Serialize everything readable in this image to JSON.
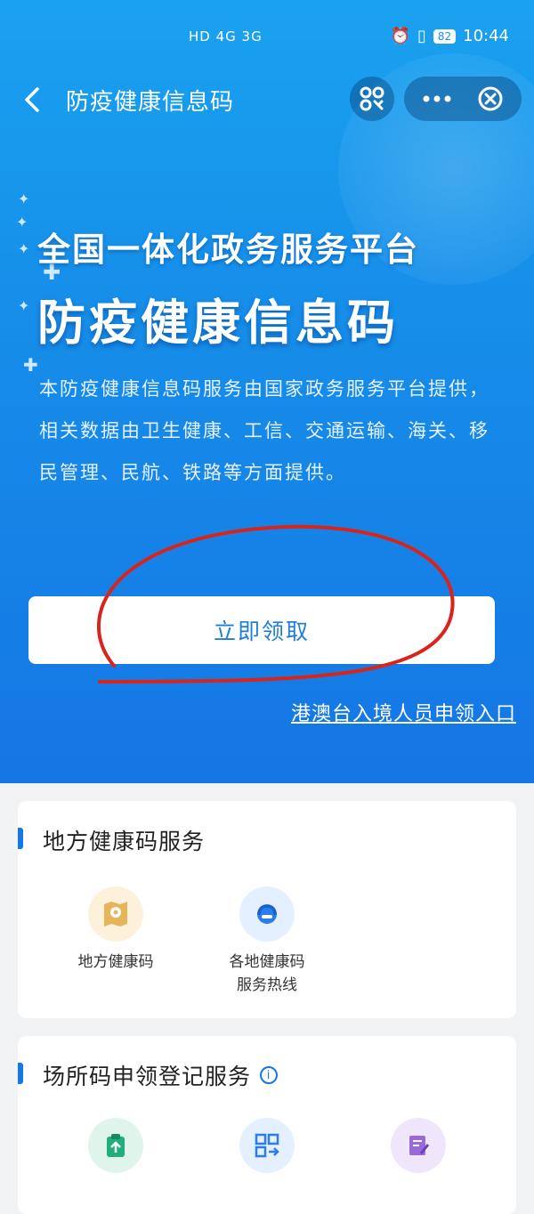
{
  "status_bar": {
    "left": "HD 4G 3G",
    "battery": "82",
    "time": "10:44"
  },
  "nav": {
    "title": "防疫健康信息码"
  },
  "hero": {
    "heading1": "全国一体化政务服务平台",
    "heading2": "防疫健康信息码",
    "description": "本防疫健康信息码服务由国家政务服务平台提供，相关数据由卫生健康、工信、交通运输、海关、移民管理、民航、铁路等方面提供。",
    "claim_button": "立即领取",
    "entry_link": "港澳台入境人员申领入口"
  },
  "local_services": {
    "title": "地方健康码服务",
    "items": [
      {
        "label": "地方健康码",
        "icon": "map-pin-icon"
      },
      {
        "label": "各地健康码\n服务热线",
        "icon": "headset-icon"
      }
    ]
  },
  "venue_services": {
    "title": "场所码申领登记服务",
    "info_icon": "info-icon",
    "items": [
      {
        "icon": "clipboard-upload-icon"
      },
      {
        "icon": "qr-arrow-icon"
      },
      {
        "icon": "edit-document-icon"
      }
    ]
  },
  "colors": {
    "primary": "#1677e5",
    "hero_top": "#1aa2ef",
    "hero_bottom": "#1576e4",
    "annotation": "#d9241c"
  }
}
